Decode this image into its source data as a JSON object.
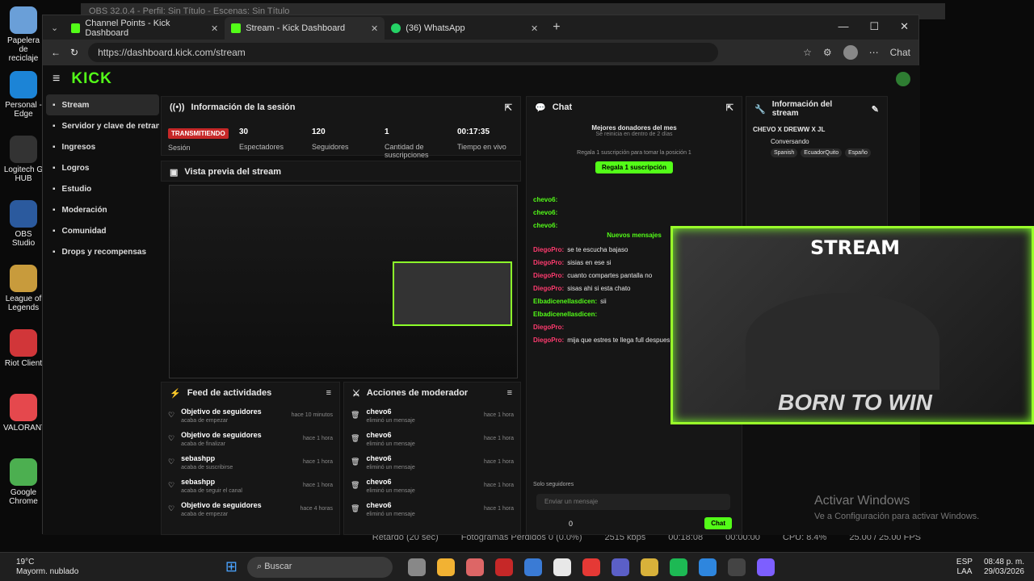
{
  "obs_title": "OBS 32.0.4 - Perfil: Sin Título - Escenas: Sin Título",
  "desktop": [
    "Papelera de reciclaje",
    "Personal - Edge",
    "Logitech G HUB",
    "OBS Studio",
    "League of Legends",
    "Riot Client",
    "VALORANT",
    "Google Chrome"
  ],
  "tabs": [
    {
      "label": "Channel Points - Kick Dashboard"
    },
    {
      "label": "Stream - Kick Dashboard"
    },
    {
      "label": "(36) WhatsApp"
    }
  ],
  "url": "https://dashboard.kick.com/stream",
  "chat_btn": "Chat",
  "logo": "KICK",
  "sidebar": [
    "Stream",
    "Servidor y clave de retransmisión",
    "Ingresos",
    "Logros",
    "Estudio",
    "Moderación",
    "Comunidad",
    "Drops y recompensas"
  ],
  "session": {
    "title": "Información de la sesión",
    "live": "TRANSMITIENDO",
    "live_sub": "Sesión",
    "stats": [
      {
        "v": "30",
        "l": "Espectadores"
      },
      {
        "v": "120",
        "l": "Seguidores"
      },
      {
        "v": "1",
        "l": "Cantidad de suscripciones"
      },
      {
        "v": "00:17:35",
        "l": "Tiempo en vivo"
      }
    ]
  },
  "preview_title": "Vista previa del stream",
  "chat": {
    "title": "Chat",
    "top": "Mejores donadores del mes",
    "top_sub": "Se reinicia en dentro de 2 días",
    "gift_hint": "Regala 1 suscripción para tomar la posición 1",
    "gift_btn": "Regala 1 suscripción",
    "new": "Nuevos mensajes",
    "followers": "Solo seguidores",
    "placeholder": "Enviar un mensaje",
    "send": "Chat",
    "count": "0",
    "msgs": [
      {
        "u": "chevo6:",
        "t": ""
      },
      {
        "u": "chevo6:",
        "t": ""
      },
      {
        "u": "chevo6:",
        "t": ""
      },
      {
        "u": "DiegoPro:",
        "t": "se te escucha bajaso"
      },
      {
        "u": "DiegoPro:",
        "t": "sisias en ese si"
      },
      {
        "u": "DiegoPro:",
        "t": "cuanto compartes pantalla no"
      },
      {
        "u": "DiegoPro:",
        "t": "sisas ahi si esta chato"
      },
      {
        "u": "Elbadicenellasdicen:",
        "t": "sii"
      },
      {
        "u": "Elbadicenellasdicen:",
        "t": ""
      },
      {
        "u": "DiegoPro:",
        "t": ""
      },
      {
        "u": "DiegoPro:",
        "t": "mija que estres te llega full despues"
      }
    ]
  },
  "info": {
    "title": "Información del stream",
    "name": "CHEVO X DREWW X JL",
    "cat": "Conversando",
    "tags": [
      "Spanish",
      "EcuadorQuito",
      "Españo"
    ]
  },
  "feed": {
    "title": "Feed de actividades",
    "items": [
      {
        "t": "Objetivo de seguidores",
        "s": "acaba de empezar",
        "h": "hace 10 minutos"
      },
      {
        "t": "Objetivo de seguidores",
        "s": "acaba de finalizar",
        "h": "hace 1 hora"
      },
      {
        "t": "sebashpp",
        "s": "acaba de suscribirse",
        "h": "hace 1 hora"
      },
      {
        "t": "sebashpp",
        "s": "acaba de seguir el canal",
        "h": "hace 1 hora"
      },
      {
        "t": "Objetivo de seguidores",
        "s": "acaba de empezar",
        "h": "hace 4 horas"
      }
    ]
  },
  "mod": {
    "title": "Acciones de moderador",
    "items": [
      {
        "t": "chevo6",
        "s": "eliminó un mensaje",
        "h": "hace 1 hora"
      },
      {
        "t": "chevo6",
        "s": "eliminó un mensaje",
        "h": "hace 1 hora"
      },
      {
        "t": "chevo6",
        "s": "eliminó un mensaje",
        "h": "hace 1 hora"
      },
      {
        "t": "chevo6",
        "s": "eliminó un mensaje",
        "h": "hace 1 hora"
      },
      {
        "t": "chevo6",
        "s": "eliminó un mensaje",
        "h": "hace 1 hora"
      }
    ]
  },
  "overlay": {
    "top": "STREAM",
    "bottom": "BORN TO WIN"
  },
  "obs_status": [
    "Retardo (20 sec)",
    "Fotogramas Perdidos 0 (0.0%)",
    "2515 kbps",
    "00:18:08",
    "00:00:00",
    "CPU: 8.4%",
    "25.00 / 25.00 FPS"
  ],
  "activate": {
    "t": "Activar Windows",
    "s": "Ve a Configuración para activar Windows."
  },
  "weather": {
    "t": "19°C",
    "s": "Mayorm. nublado"
  },
  "search": "Buscar",
  "lang": {
    "a": "ESP",
    "b": "LAA"
  },
  "clock": {
    "t": "08:48 p. m.",
    "d": "29/03/2026"
  }
}
